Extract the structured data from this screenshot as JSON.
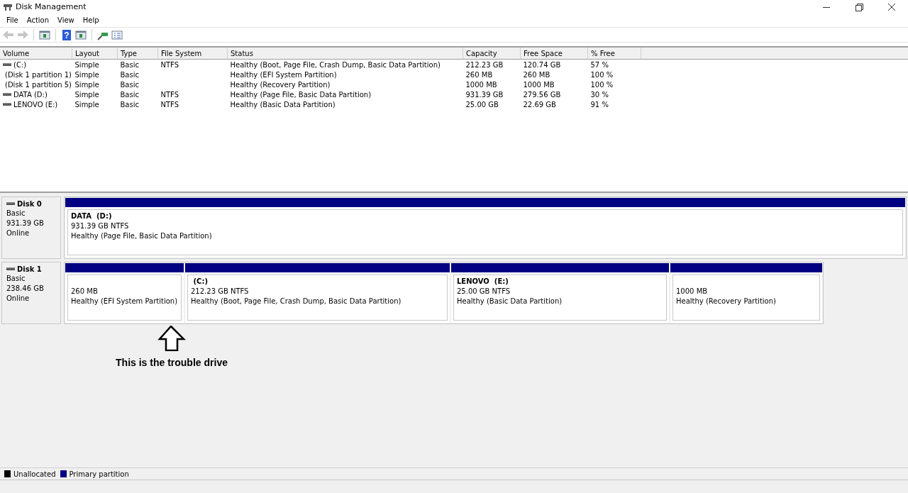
{
  "window": {
    "title": "Disk Management"
  },
  "menu": [
    "File",
    "Action",
    "View",
    "Help"
  ],
  "toolbar": [
    {
      "kind": "back",
      "disabled": true
    },
    {
      "kind": "forward",
      "disabled": true
    },
    {
      "kind": "sep"
    },
    {
      "kind": "panel",
      "disabled": false
    },
    {
      "kind": "sep"
    },
    {
      "kind": "help",
      "disabled": false,
      "text": "?"
    },
    {
      "kind": "panel",
      "disabled": false
    },
    {
      "kind": "sep"
    },
    {
      "kind": "connect",
      "disabled": false
    },
    {
      "kind": "list",
      "disabled": false
    }
  ],
  "table": {
    "columns": [
      "Volume",
      "Layout",
      "Type",
      "File System",
      "Status",
      "Capacity",
      "Free Space",
      "% Free"
    ],
    "rows": [
      {
        "cells": [
          " (C:)",
          "Simple",
          "Basic",
          "NTFS",
          "Healthy (Boot, Page File, Crash Dump, Basic Data Partition)",
          "212.23 GB",
          "120.74 GB",
          "57 %"
        ]
      },
      {
        "cells": [
          "(Disk 1 partition 1)",
          "Simple",
          "Basic",
          "",
          "Healthy (EFI System Partition)",
          "260 MB",
          "260 MB",
          "100 %"
        ]
      },
      {
        "cells": [
          "(Disk 1 partition 5)",
          "Simple",
          "Basic",
          "",
          "Healthy (Recovery Partition)",
          "1000 MB",
          "1000 MB",
          "100 %"
        ]
      },
      {
        "cells": [
          "DATA (D:)",
          "Simple",
          "Basic",
          "NTFS",
          "Healthy (Page File, Basic Data Partition)",
          "931.39 GB",
          "279.56 GB",
          "30 %"
        ]
      },
      {
        "cells": [
          "LENOVO (E:)",
          "Simple",
          "Basic",
          "NTFS",
          "Healthy (Basic Data Partition)",
          "25.00 GB",
          "22.69 GB",
          "91 %"
        ]
      }
    ]
  },
  "disks": [
    {
      "name": "Disk 0",
      "type": "Basic",
      "size": "931.39 GB",
      "status": "Online",
      "partitions": [
        {
          "kind": "primary",
          "label": "DATA  (D:)",
          "size": "931.39 GB NTFS",
          "status": "Healthy (Page File, Basic Data Partition)"
        }
      ]
    },
    {
      "name": "Disk 1",
      "type": "Basic",
      "size": "238.46 GB",
      "status": "Online",
      "partitions": [
        {
          "kind": "primary",
          "size": "260 MB",
          "status": "Healthy (EFI System Partition)"
        },
        {
          "kind": "primary",
          "label": " (C:)",
          "size": "212.23 GB NTFS",
          "status": "Healthy (Boot, Page File, Crash Dump, Basic Data Partition)"
        },
        {
          "kind": "primary",
          "label": "LENOVO  (E:)",
          "size": "25.00 GB NTFS",
          "status": "Healthy (Basic Data Partition)"
        },
        {
          "kind": "primary",
          "size": "1000 MB",
          "status": "Healthy (Recovery Partition)"
        }
      ]
    }
  ],
  "annotation": {
    "text": "This is the trouble drive"
  },
  "legend": [
    {
      "label": "Unallocated",
      "color": "#000000"
    },
    {
      "label": "Primary partition",
      "color": "#000080"
    }
  ]
}
